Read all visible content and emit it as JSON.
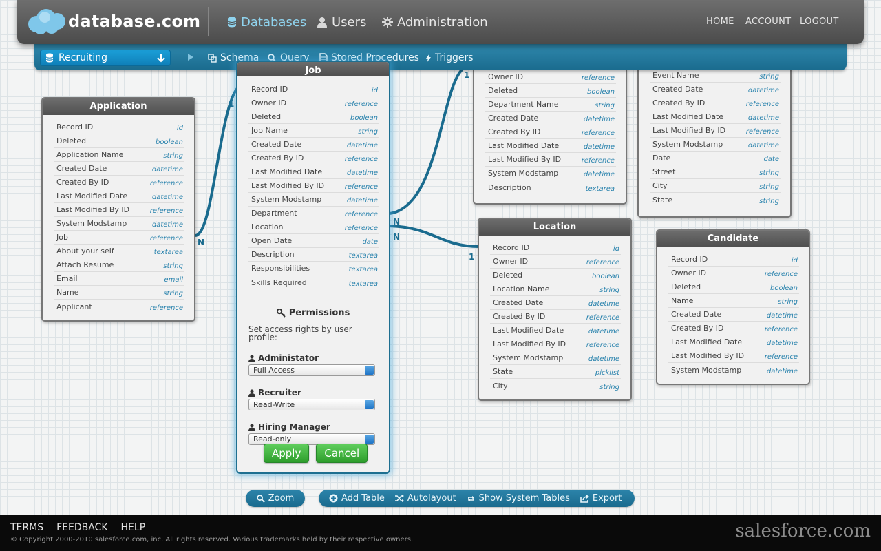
{
  "header": {
    "brand": "database.com",
    "nav": [
      {
        "label": "Databases",
        "icon": "database-icon",
        "active": true
      },
      {
        "label": "Users",
        "icon": "user-icon",
        "active": false
      },
      {
        "label": "Administration",
        "icon": "gear-icon",
        "active": false
      }
    ],
    "links": [
      "HOME",
      "ACCOUNT",
      "LOGOUT"
    ]
  },
  "subnav": {
    "database_selected": "Recruiting",
    "items": [
      {
        "label": "Schema",
        "icon": "schema-icon"
      },
      {
        "label": "Query",
        "icon": "search-icon"
      },
      {
        "label": "Stored Procedures",
        "icon": "document-icon"
      },
      {
        "label": "Triggers",
        "icon": "lightning-icon"
      }
    ]
  },
  "tables": {
    "application": {
      "title": "Application",
      "fields": [
        {
          "name": "Record ID",
          "type": "id"
        },
        {
          "name": "Deleted",
          "type": "boolean"
        },
        {
          "name": "Application Name",
          "type": "string"
        },
        {
          "name": "Created Date",
          "type": "datetime"
        },
        {
          "name": "Created By ID",
          "type": "reference"
        },
        {
          "name": "Last Modified Date",
          "type": "datetime"
        },
        {
          "name": "Last Modified By ID",
          "type": "reference"
        },
        {
          "name": "System Modstamp",
          "type": "datetime"
        },
        {
          "name": "Job",
          "type": "reference"
        },
        {
          "name": "About your self",
          "type": "textarea"
        },
        {
          "name": "Attach Resume",
          "type": "string"
        },
        {
          "name": "Email",
          "type": "email"
        },
        {
          "name": "Name",
          "type": "string"
        },
        {
          "name": "Applicant",
          "type": "reference"
        }
      ]
    },
    "job": {
      "title": "Job",
      "fields": [
        {
          "name": "Record ID",
          "type": "id"
        },
        {
          "name": "Owner ID",
          "type": "reference"
        },
        {
          "name": "Deleted",
          "type": "boolean"
        },
        {
          "name": "Job Name",
          "type": "string"
        },
        {
          "name": "Created Date",
          "type": "datetime"
        },
        {
          "name": "Created By ID",
          "type": "reference"
        },
        {
          "name": "Last Modified Date",
          "type": "datetime"
        },
        {
          "name": "Last Modified By ID",
          "type": "reference"
        },
        {
          "name": "System Modstamp",
          "type": "datetime"
        },
        {
          "name": "Department",
          "type": "reference"
        },
        {
          "name": "Location",
          "type": "reference"
        },
        {
          "name": "Open Date",
          "type": "date"
        },
        {
          "name": "Description",
          "type": "textarea"
        },
        {
          "name": "Responsibilities",
          "type": "textarea"
        },
        {
          "name": "Skills Required",
          "type": "textarea"
        }
      ],
      "permissions": {
        "title": "Permissions",
        "description": "Set access rights by user profile:",
        "profiles": [
          {
            "label": "Administator",
            "value": "Full Access"
          },
          {
            "label": "Recruiter",
            "value": "Read-Write"
          },
          {
            "label": "Hiring Manager",
            "value": "Read-only"
          }
        ],
        "apply_label": "Apply",
        "cancel_label": "Cancel"
      }
    },
    "department": {
      "fields": [
        {
          "name": "Owner ID",
          "type": "reference"
        },
        {
          "name": "Deleted",
          "type": "boolean"
        },
        {
          "name": "Department Name",
          "type": "string"
        },
        {
          "name": "Created Date",
          "type": "datetime"
        },
        {
          "name": "Created By ID",
          "type": "reference"
        },
        {
          "name": "Last Modified Date",
          "type": "datetime"
        },
        {
          "name": "Last Modified By ID",
          "type": "reference"
        },
        {
          "name": "System Modstamp",
          "type": "datetime"
        },
        {
          "name": "Description",
          "type": "textarea"
        }
      ]
    },
    "event": {
      "fields": [
        {
          "name": "Event Name",
          "type": "string"
        },
        {
          "name": "Created Date",
          "type": "datetime"
        },
        {
          "name": "Created By ID",
          "type": "reference"
        },
        {
          "name": "Last Modified Date",
          "type": "datetime"
        },
        {
          "name": "Last Modified By ID",
          "type": "reference"
        },
        {
          "name": "System Modstamp",
          "type": "datetime"
        },
        {
          "name": "Date",
          "type": "date"
        },
        {
          "name": "Street",
          "type": "string"
        },
        {
          "name": "City",
          "type": "string"
        },
        {
          "name": "State",
          "type": "string"
        }
      ]
    },
    "location": {
      "title": "Location",
      "fields": [
        {
          "name": "Record ID",
          "type": "id"
        },
        {
          "name": "Owner ID",
          "type": "reference"
        },
        {
          "name": "Deleted",
          "type": "boolean"
        },
        {
          "name": "Location Name",
          "type": "string"
        },
        {
          "name": "Created Date",
          "type": "datetime"
        },
        {
          "name": "Created By ID",
          "type": "reference"
        },
        {
          "name": "Last Modified Date",
          "type": "datetime"
        },
        {
          "name": "Last Modified By ID",
          "type": "reference"
        },
        {
          "name": "System Modstamp",
          "type": "datetime"
        },
        {
          "name": "State",
          "type": "picklist"
        },
        {
          "name": "City",
          "type": "string"
        }
      ]
    },
    "candidate": {
      "title": "Candidate",
      "fields": [
        {
          "name": "Record ID",
          "type": "id"
        },
        {
          "name": "Owner ID",
          "type": "reference"
        },
        {
          "name": "Deleted",
          "type": "boolean"
        },
        {
          "name": "Name",
          "type": "string"
        },
        {
          "name": "Created Date",
          "type": "datetime"
        },
        {
          "name": "Created By ID",
          "type": "reference"
        },
        {
          "name": "Last Modified Date",
          "type": "datetime"
        },
        {
          "name": "Last Modified By ID",
          "type": "reference"
        },
        {
          "name": "System Modstamp",
          "type": "datetime"
        }
      ]
    }
  },
  "relationships": {
    "one": "1",
    "many": "N"
  },
  "toolbar": {
    "zoom_label": "Zoom",
    "items": [
      {
        "label": "Add Table",
        "icon": "plus-circle-icon"
      },
      {
        "label": "Autolayout",
        "icon": "shuffle-icon"
      },
      {
        "label": "Show System Tables",
        "icon": "refresh-icon"
      },
      {
        "label": "Export",
        "icon": "export-icon"
      }
    ]
  },
  "footer": {
    "links": [
      "TERMS",
      "FEEDBACK",
      "HELP"
    ],
    "copyright": "© Copyright 2000-2010 salesforce.com, inc. All rights reserved. Various trademarks held by their respective owners.",
    "brand": "salesforce.com"
  },
  "colors": {
    "accent": "#1a6b8e",
    "header": "#555555",
    "type_text": "#2a83ad",
    "button_green": "#3aab37"
  }
}
